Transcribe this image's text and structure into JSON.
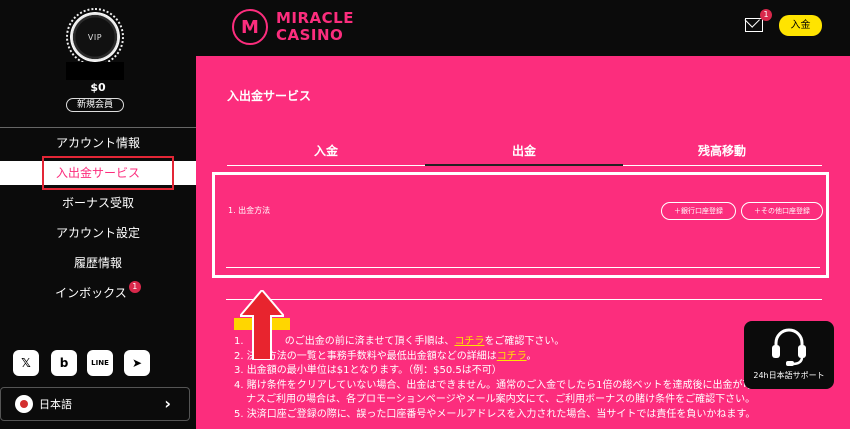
{
  "sidebar": {
    "vip_label": "VIP",
    "balance": "$0",
    "member_status": "新規会員",
    "menu": [
      {
        "label": "アカウント情報"
      },
      {
        "label": "入出金サービス"
      },
      {
        "label": "ボーナス受取"
      },
      {
        "label": "アカウント設定"
      },
      {
        "label": "履歴情報"
      },
      {
        "label": "インボックス",
        "badge": "1"
      }
    ],
    "social": [
      {
        "icon": "x-icon",
        "glyph": "𝕏"
      },
      {
        "icon": "bluesky-b-icon",
        "glyph": "b"
      },
      {
        "icon": "line-icon",
        "glyph": "LINE"
      },
      {
        "icon": "telegram-icon",
        "glyph": "➤"
      }
    ],
    "language": "日本語"
  },
  "header": {
    "logo_mark": "M",
    "logo_line1": "MIRACLE",
    "logo_line2": "CASINO",
    "mail_badge": "1",
    "deposit_button": "入金"
  },
  "main": {
    "section_title": "入出金サービス",
    "tabs": [
      {
        "label": "入金"
      },
      {
        "label": "出金"
      },
      {
        "label": "残高移動"
      }
    ],
    "method_label": "1. 出金方法",
    "register_bank": "＋銀行口座登録",
    "register_other": "＋その他口座登録",
    "notes": {
      "line1_pre": "1. ",
      "line1_mid": "のご出金の前に済ませて頂く手順は、",
      "line1_link": "コチラ",
      "line1_post": "をご確認下さい。",
      "line2_pre": "2. 決済方法の一覧と事務手数料や最低出金額などの詳細は",
      "line2_link": "コチラ",
      "line2_post": "。",
      "line3": "3. 出金額の最小単位は$1となります。（例：$50.5は不可）",
      "line4": "4. 賭け条件をクリアしていない場合、出金はできません。通常のご入金でしたら1倍の総ベットを達成後に出金が可能です。ボー",
      "line4b": "ナスご利用の場合は、各プロモーションページやメール案内文にて、ご利用ボーナスの賭け条件をご確認下さい。",
      "line5": "5. 決済口座ご登録の際に、誤った口座番号やメールアドレスを入力された場合、当サイトでは責任を負いかねます。"
    }
  },
  "support": {
    "label": "24h日本語サポート"
  },
  "colors": {
    "brand_pink": "#fc2d7d",
    "accent_yellow": "#ffe400",
    "sidebar_bg": "#0b0b0b",
    "highlight_red": "#e32636"
  }
}
